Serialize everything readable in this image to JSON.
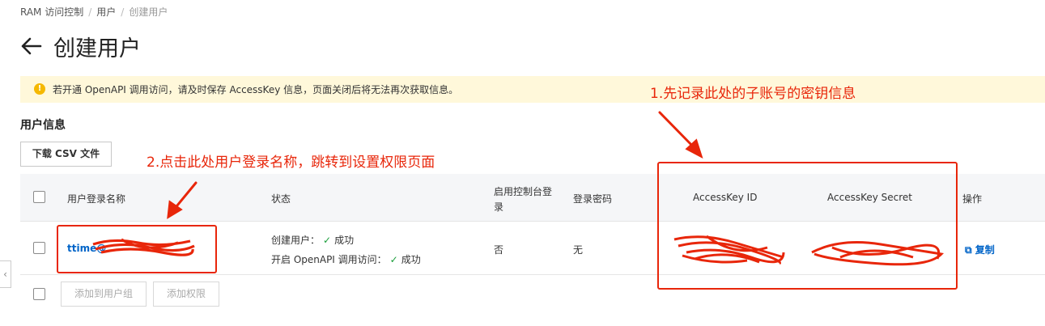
{
  "breadcrumb": {
    "root": "RAM 访问控制",
    "mid": "用户",
    "current": "创建用户",
    "separator": "/"
  },
  "page": {
    "title": "创建用户"
  },
  "notice": {
    "icon": "warning-icon",
    "text": "若开通 OpenAPI 调用访问，请及时保存 AccessKey 信息，页面关闭后将无法再次获取信息。"
  },
  "section": {
    "title": "用户信息"
  },
  "buttons": {
    "download": "下载 CSV 文件",
    "add_to_group": "添加到用户组",
    "add_permission": "添加权限"
  },
  "table": {
    "headers": {
      "login_name": "用户登录名称",
      "status": "状态",
      "console_login_1": "启用控制台登",
      "console_login_2": "录",
      "password": "登录密码",
      "ak_id": "AccessKey ID",
      "ak_secret": "AccessKey Secret",
      "ops": "操作"
    },
    "row": {
      "login_name": "ttime@",
      "status_1_label": "创建用户：",
      "status_1_value": "成功",
      "status_2_label": "开启 OpenAPI 调用访问：",
      "status_2_value": "成功",
      "check_mark": "✓",
      "console_login": "否",
      "password": "无",
      "copy": "复制",
      "copy_icon": "copy-icon"
    }
  },
  "annotations": {
    "step1": "1.先记录此处的子账号的密钥信息",
    "step2": "2.点击此处用户登录名称，跳转到设置权限页面",
    "color": "#e8260a"
  },
  "colors": {
    "link": "#0064c8",
    "success": "#1a9e3a",
    "notice_bg": "#fff8da",
    "notice_icon": "#f5b800"
  }
}
